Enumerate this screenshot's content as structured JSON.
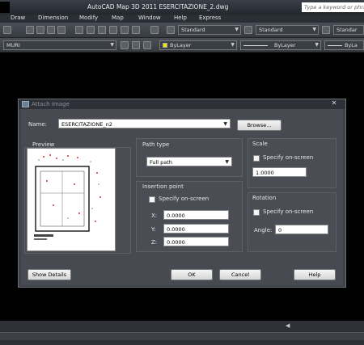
{
  "window": {
    "title": "AutoCAD Map 3D 2011    ESERCITAZIONE_2.dwg",
    "search_placeholder": "Type a keyword or phras"
  },
  "menu": [
    "Draw",
    "Dimension",
    "Modify",
    "Map",
    "Window",
    "Help",
    "Express"
  ],
  "toolbar1": {
    "text_style_combo": "Standard",
    "dim_style_combo": "Standard",
    "table_style_combo": "Standar"
  },
  "toolbar2": {
    "layer_combo": "MURI",
    "color_combo": "ByLayer",
    "linetype_combo": "ByLayer",
    "lineweight_combo": "ByLa"
  },
  "dialog": {
    "title": "Attach Image",
    "name_label": "Name:",
    "name_value": "ESERCITAZIONE_n2",
    "browse_label": "Browse...",
    "preview_label": "Preview",
    "path_type": {
      "label": "Path type",
      "value": "Full path"
    },
    "scale": {
      "label": "Scale",
      "specify_label": "Specify on-screen",
      "value": "1.0000"
    },
    "insertion": {
      "label": "Insertion point",
      "specify_label": "Specify on-screen",
      "x_label": "X:",
      "x_value": "0.0000",
      "y_label": "Y:",
      "y_value": "0.0000",
      "z_label": "Z:",
      "z_value": "0.0000"
    },
    "rotation": {
      "label": "Rotation",
      "specify_label": "Specify on-screen",
      "angle_label": "Angle:",
      "angle_value": "0"
    },
    "buttons": {
      "show_details": "Show Details",
      "ok": "OK",
      "cancel": "Cancel",
      "help": "Help"
    }
  },
  "colors": {
    "background": "#000000",
    "dialog": "#474a51",
    "bylayer_swatch": "#f3e012"
  }
}
